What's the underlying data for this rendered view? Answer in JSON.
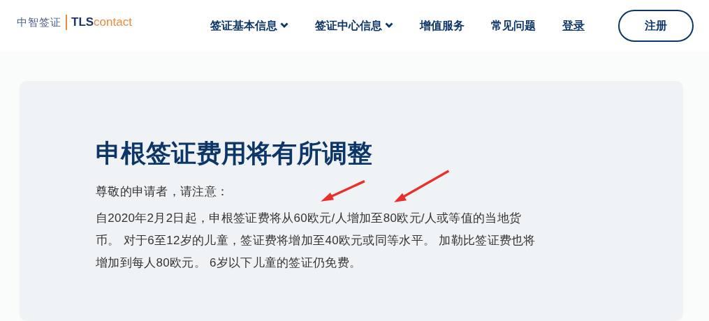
{
  "logo": {
    "cn": "中智签证",
    "brand_bold": "TLS",
    "brand_light": "contact"
  },
  "nav": [
    {
      "label": "签证基本信息",
      "kind": "dropdown"
    },
    {
      "label": "签证中心信息",
      "kind": "dropdown"
    },
    {
      "label": "增值服务",
      "kind": "link"
    },
    {
      "label": "常见问题",
      "kind": "link"
    },
    {
      "label": "登录",
      "kind": "underlined"
    }
  ],
  "register_button": "注册",
  "article": {
    "title": "申根签证费用将有所调整",
    "paragraphs": [
      "尊敬的申请者，请注意：",
      "自2020年2月2日起，申根签证费将从60欧元/人增加至80欧元/人或等值的当地货币。 对于6至12岁的儿童，签证费将增加至40欧元或同等水平。 加勒比签证费也将增加到每人80欧元。 6岁以下儿童的签证仍免费。"
    ]
  }
}
